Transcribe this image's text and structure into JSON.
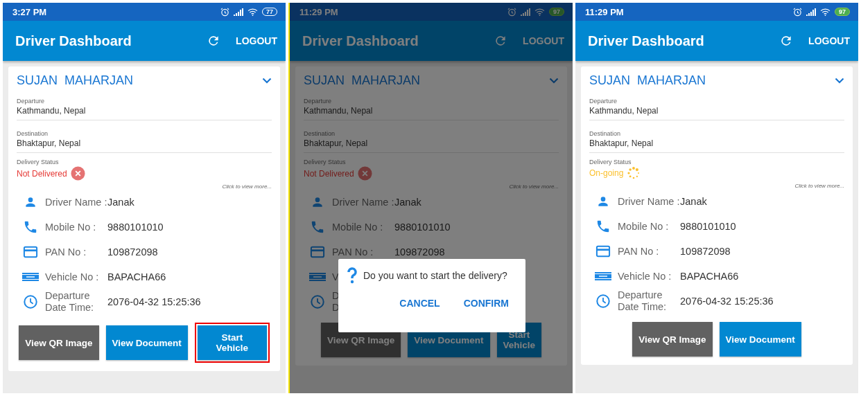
{
  "screens": [
    {
      "status_bar": {
        "time": "3:27 PM",
        "battery": "77",
        "charging": false
      },
      "app_bar": {
        "title": "Driver Dashboard",
        "action": "LOGOUT"
      },
      "card": {
        "name": "SUJAN  MAHARJAN",
        "fields": [
          {
            "label": "Departure",
            "value": "Kathmandu, Nepal"
          },
          {
            "label": "Destination",
            "value": "Bhaktapur, Nepal"
          }
        ],
        "status": {
          "label": "Delivery Status",
          "value": "Not Delivered",
          "kind": "not_delivered"
        },
        "more_link": "Click to view more...",
        "details": [
          {
            "kind": "person",
            "label": "Driver Name :",
            "value": "Janak"
          },
          {
            "kind": "phone",
            "label": "Mobile No :",
            "value": "9880101010"
          },
          {
            "kind": "card",
            "label": "PAN No :",
            "value": "109872098"
          },
          {
            "kind": "plate",
            "label": "Vehicle No :",
            "value": "BAPACHA66"
          },
          {
            "kind": "clock",
            "label": "Departure\nDate Time:",
            "value": "2076-04-32 15:25:36"
          }
        ],
        "buttons": [
          {
            "label": "View QR Image",
            "kind": "grey",
            "highlighted": false
          },
          {
            "label": "View Document",
            "kind": "blue",
            "highlighted": false
          },
          {
            "label": "Start\nVehicle",
            "kind": "blue",
            "highlighted": true
          }
        ]
      }
    },
    {
      "status_bar": {
        "time": "11:29 PM",
        "battery": "97",
        "charging": true
      },
      "app_bar": {
        "title": "Driver Dashboard",
        "action": "LOGOUT"
      },
      "card": {
        "name": "SUJAN  MAHARJAN",
        "fields": [
          {
            "label": "Departure",
            "value": "Kathmandu, Nepal"
          },
          {
            "label": "Destination",
            "value": "Bhaktapur, Nepal"
          }
        ],
        "status": {
          "label": "Delivery Status",
          "value": "Not Delivered",
          "kind": "not_delivered"
        },
        "more_link": "Click to view more...",
        "details": [
          {
            "kind": "person",
            "label": "Driver Name :",
            "value": "Janak"
          },
          {
            "kind": "phone",
            "label": "Mobile No :",
            "value": "9880101010"
          },
          {
            "kind": "card",
            "label": "PAN No :",
            "value": "109872098"
          },
          {
            "kind": "plate",
            "label": "V"
          },
          {
            "kind": "clock",
            "label": "D\nD"
          }
        ],
        "buttons": [
          {
            "label": "View QR Image",
            "kind": "grey",
            "highlighted": false
          },
          {
            "label": "View Document",
            "kind": "blue",
            "highlighted": false
          },
          {
            "label": "Start\nVehicle",
            "kind": "blue",
            "highlighted": false
          }
        ]
      },
      "dialog": {
        "message": "Do you want to start the delivery?",
        "buttons": [
          "CANCEL",
          "CONFIRM"
        ]
      }
    },
    {
      "status_bar": {
        "time": "11:29 PM",
        "battery": "97",
        "charging": true
      },
      "app_bar": {
        "title": "Driver Dashboard",
        "action": "LOGOUT"
      },
      "card": {
        "name": "SUJAN  MAHARJAN",
        "fields": [
          {
            "label": "Departure",
            "value": "Kathmandu, Nepal"
          },
          {
            "label": "Destination",
            "value": "Bhaktapur, Nepal"
          }
        ],
        "status": {
          "label": "Delivery Status",
          "value": "On-going",
          "kind": "ongoing"
        },
        "more_link": "Click to view more...",
        "details": [
          {
            "kind": "person",
            "label": "Driver Name :",
            "value": "Janak"
          },
          {
            "kind": "phone",
            "label": "Mobile No :",
            "value": "9880101010"
          },
          {
            "kind": "card",
            "label": "PAN No :",
            "value": "109872098"
          },
          {
            "kind": "plate",
            "label": "Vehicle No :",
            "value": "BAPACHA66"
          },
          {
            "kind": "clock",
            "label": "Departure\nDate Time:",
            "value": "2076-04-32 15:25:36"
          }
        ],
        "buttons": [
          {
            "label": "View QR Image",
            "kind": "grey",
            "highlighted": false
          },
          {
            "label": "View Document",
            "kind": "blue",
            "highlighted": false
          }
        ]
      }
    }
  ]
}
